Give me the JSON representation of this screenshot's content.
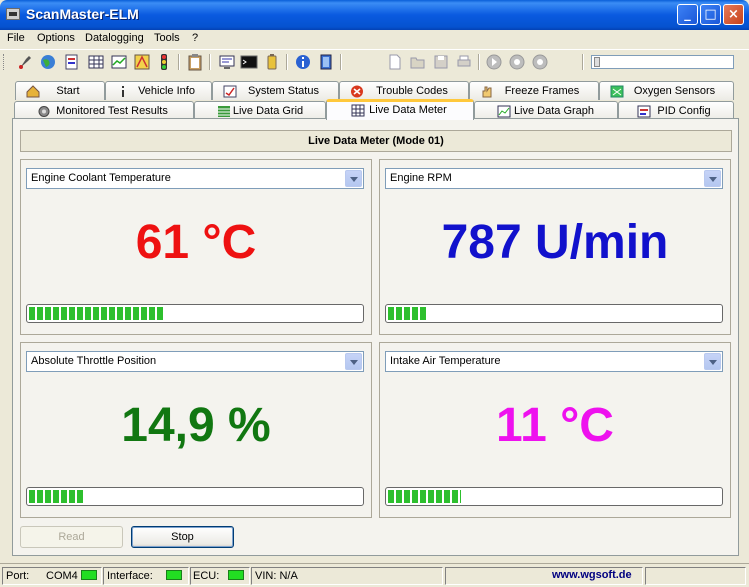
{
  "window": {
    "title": "ScanMaster-ELM"
  },
  "menu": [
    "File",
    "Options",
    "Datalogging",
    "Tools",
    "?"
  ],
  "toolbar": {
    "icons": [
      "probe-icon",
      "globe-icon",
      "document-icon",
      "grid-icon",
      "chart-icon",
      "map-icon",
      "traffic-light-icon",
      "clipboard-icon",
      "monitor-icon",
      "terminal-icon",
      "battery-icon",
      "info-icon",
      "exit-icon",
      "new-file-icon",
      "open-file-icon",
      "save-icon",
      "print-icon",
      "play-icon",
      "pause-icon",
      "stop-icon"
    ]
  },
  "tabs_row1": [
    {
      "label": "Start",
      "icon": "home-icon"
    },
    {
      "label": "Vehicle Info",
      "icon": "info-icon"
    },
    {
      "label": "System Status",
      "icon": "status-icon"
    },
    {
      "label": "Trouble Codes",
      "icon": "error-icon"
    },
    {
      "label": "Freeze Frames",
      "icon": "hand-icon"
    },
    {
      "label": "Oxygen Sensors",
      "icon": "sensor-icon"
    }
  ],
  "tabs_row2": [
    {
      "label": "Monitored Test Results",
      "icon": "gear-icon"
    },
    {
      "label": "Live Data Grid",
      "icon": "grid-icon"
    },
    {
      "label": "Live Data Meter",
      "icon": "meter-icon"
    },
    {
      "label": "Live Data Graph",
      "icon": "graph-icon"
    },
    {
      "label": "PID Config",
      "icon": "config-icon"
    }
  ],
  "panel": {
    "title": "Live Data Meter (Mode 01)"
  },
  "meters": [
    {
      "parameter": "Engine Coolant Temperature",
      "value": "61 °C",
      "color": "#ee1111",
      "level": 0.41
    },
    {
      "parameter": "Engine RPM",
      "value": "787 U/min",
      "color": "#1111cc",
      "level": 0.12
    },
    {
      "parameter": "Absolute Throttle Position",
      "value": "14,9 %",
      "color": "#117711",
      "level": 0.17
    },
    {
      "parameter": "Intake Air Temperature",
      "value": "11 °C",
      "color": "#ee11ee",
      "level": 0.22
    }
  ],
  "buttons": {
    "read": "Read",
    "stop": "Stop"
  },
  "status": {
    "port_label": "Port:",
    "port_value": "COM4",
    "interface_label": "Interface:",
    "ecu_label": "ECU:",
    "vin": "VIN: N/A",
    "link": "www.wgsoft.de"
  }
}
